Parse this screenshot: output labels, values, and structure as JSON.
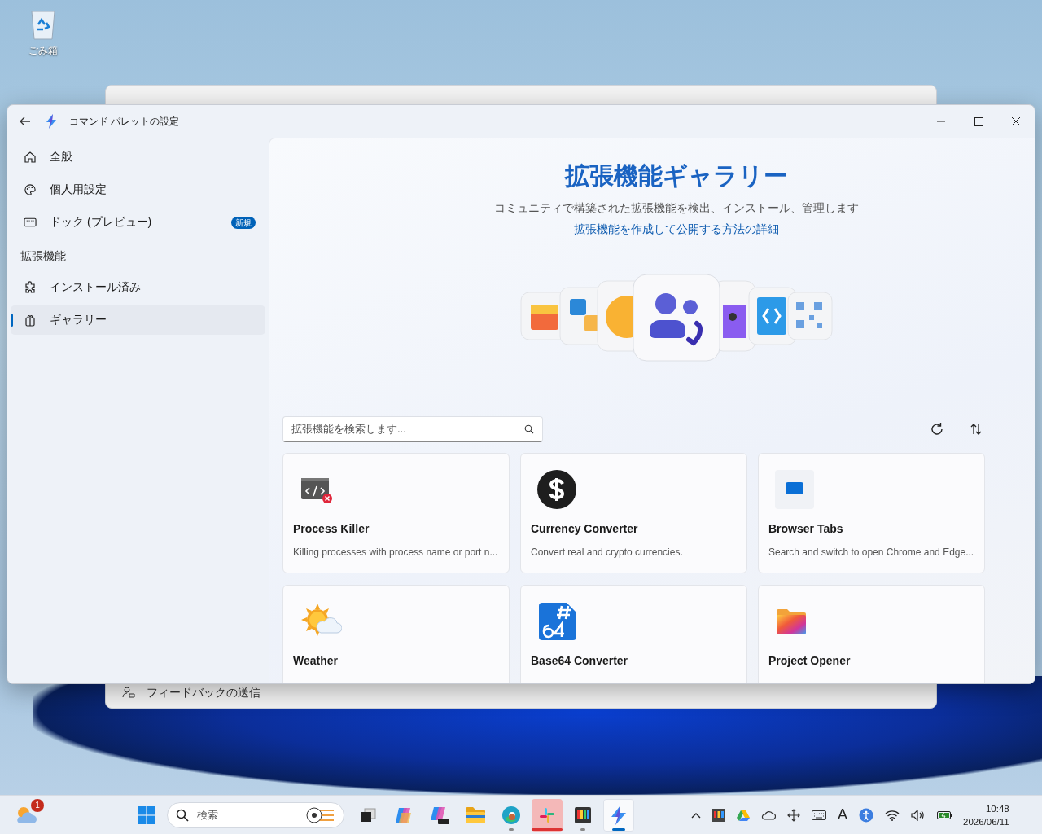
{
  "desktop": {
    "icons": [
      {
        "label": "ごみ箱"
      }
    ]
  },
  "background_window": {
    "footer_item": "フィードバックの送信"
  },
  "window": {
    "title": "コマンド パレットの設定"
  },
  "sidebar": {
    "items": [
      {
        "kind": "item",
        "label": "全般",
        "selected": false
      },
      {
        "kind": "item",
        "label": "個人用設定",
        "selected": false
      },
      {
        "kind": "item",
        "label": "ドック (プレビュー)",
        "badge": "新規",
        "selected": false
      },
      {
        "kind": "header",
        "label": "拡張機能"
      },
      {
        "kind": "item",
        "label": "インストール済み",
        "selected": false
      },
      {
        "kind": "item",
        "label": "ギャラリー",
        "selected": true
      }
    ]
  },
  "hero": {
    "title": "拡張機能ギャラリー",
    "subtitle": "コミュニティで構築された拡張機能を検出、インストール、管理します",
    "link": "拡張機能を作成して公開する方法の詳細"
  },
  "search": {
    "placeholder": "拡張機能を検索します..."
  },
  "extensions": [
    {
      "name": "Process Killer",
      "description": "Killing processes with process name or port n..."
    },
    {
      "name": "Currency Converter",
      "description": "Convert real and crypto currencies."
    },
    {
      "name": "Browser Tabs",
      "description": "Search and switch to open Chrome and Edge..."
    },
    {
      "name": "Weather"
    },
    {
      "name": "Base64 Converter"
    },
    {
      "name": "Project Opener"
    }
  ],
  "taskbar": {
    "weather_badge": "1",
    "search_placeholder": "検索",
    "apps": [
      {
        "running": false,
        "active": false,
        "attention": false
      },
      {
        "running": false,
        "active": false,
        "attention": false
      },
      {
        "running": false,
        "active": false,
        "attention": false
      },
      {
        "running": false,
        "active": false,
        "attention": false
      },
      {
        "running": true,
        "active": false,
        "attention": false
      },
      {
        "running": true,
        "active": false,
        "attention": true
      },
      {
        "running": true,
        "active": false,
        "attention": false
      },
      {
        "running": true,
        "active": true,
        "attention": false
      }
    ],
    "tray_ime": "A",
    "time": "10:48",
    "date": "2026/06/11"
  }
}
